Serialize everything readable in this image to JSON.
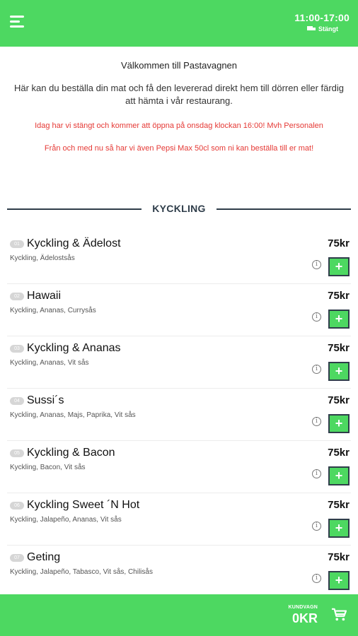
{
  "header": {
    "hours": "11:00-17:00",
    "status": "Stängt"
  },
  "intro": {
    "welcome": "Välkommen till Pastavagnen",
    "description": "Här kan du beställa din mat och få den levererad direkt hem till dörren eller färdig att hämta i vår restaurang.",
    "notice": "Idag har vi stängt och kommer att öppna på onsdag klockan 16:00! Mvh Personalen",
    "notice2": "Från och med nu så har vi även Pepsi Max 50cl som ni kan beställa till er mat!"
  },
  "section": {
    "title": "KYCKLING"
  },
  "items": [
    {
      "num": "01",
      "name": "Kyckling & Ädelost",
      "ingredients": "Kyckling, Ädelostsås",
      "price": "75kr",
      "info": "i",
      "add": "+"
    },
    {
      "num": "02",
      "name": "Hawaii",
      "ingredients": "Kyckling, Ananas, Currysås",
      "price": "75kr",
      "info": "i",
      "add": "+"
    },
    {
      "num": "03",
      "name": "Kyckling & Ananas",
      "ingredients": "Kyckling, Ananas, Vit sås",
      "price": "75kr",
      "info": "i",
      "add": "+"
    },
    {
      "num": "04",
      "name": "Sussi´s",
      "ingredients": "Kyckling, Ananas, Majs, Paprika, Vit sås",
      "price": "75kr",
      "info": "i",
      "add": "+"
    },
    {
      "num": "05",
      "name": "Kyckling & Bacon",
      "ingredients": "Kyckling, Bacon, Vit sås",
      "price": "75kr",
      "info": "i",
      "add": "+"
    },
    {
      "num": "06",
      "name": "Kyckling Sweet ´N Hot",
      "ingredients": "Kyckling, Jalapeño, Ananas, Vit sås",
      "price": "75kr",
      "info": "i",
      "add": "+"
    },
    {
      "num": "07",
      "name": "Geting",
      "ingredients": "Kyckling, Jalapeño, Tabasco, Vit sås, Chilisås",
      "price": "75kr",
      "info": "i",
      "add": "+"
    }
  ],
  "cart": {
    "label": "KUNDVAGN",
    "total": "0KR"
  },
  "icons": {
    "menu": "hamburger-menu-icon",
    "status": "truck-icon",
    "info": "info-icon",
    "cart": "shopping-cart-icon"
  },
  "colors": {
    "brand_green": "#4dd861",
    "heading_dark": "#2f3d4a",
    "notice_red": "#e53935"
  }
}
